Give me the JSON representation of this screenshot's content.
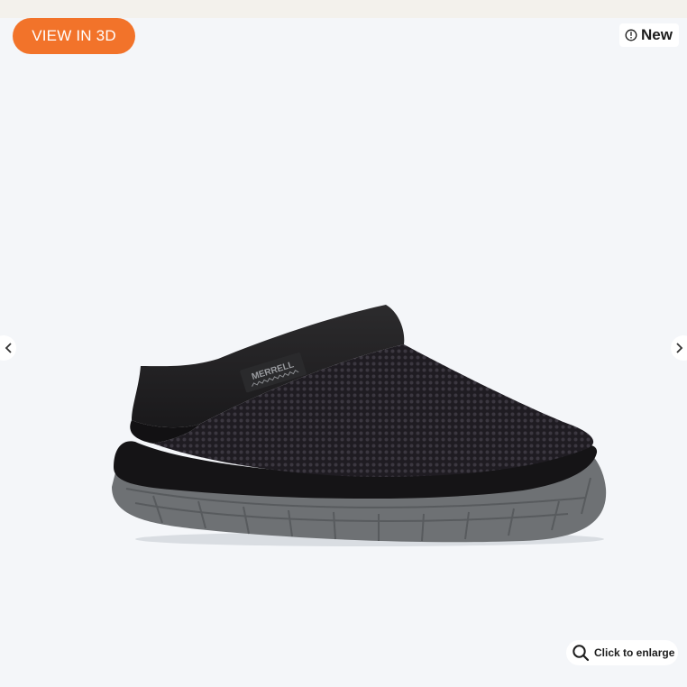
{
  "toolbar": {
    "view_3d_label": "VIEW IN 3D"
  },
  "badge": {
    "label": "New",
    "icon": "info-icon"
  },
  "gallery": {
    "prev_icon": "chevron-left-icon",
    "next_icon": "chevron-right-icon",
    "product_image": {
      "brand_text": "MERRELL",
      "alt": "Black mesh slip-on clog with grey outsole"
    }
  },
  "enlarge": {
    "label": "Click to enlarge",
    "icon": "search-icon"
  },
  "colors": {
    "accent": "#f2732a",
    "background": "#f4f6f9",
    "text": "#1c1c1c"
  }
}
